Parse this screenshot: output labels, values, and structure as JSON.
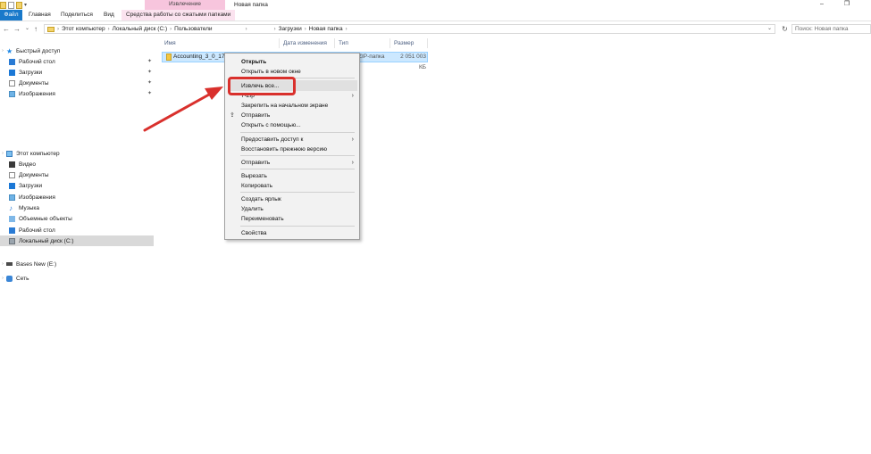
{
  "titlebar": {
    "context_header": "Извлечение",
    "window_title": "Новая папка",
    "minimize": "–",
    "maximize": "❐"
  },
  "ribbon": {
    "tabs": [
      "Файл",
      "Главная",
      "Поделиться",
      "Вид",
      "Средства работы со сжатыми папками"
    ]
  },
  "address": {
    "back": "←",
    "forward": "→",
    "recent": "⌄",
    "up": "↑",
    "crumbs": [
      "Этот компьютер",
      "Локальный диск (C:)",
      "Пользователи",
      "",
      "Загрузки",
      "Новая папка"
    ],
    "separator": "›",
    "dropdown": "⌄",
    "refresh": "↻",
    "search_placeholder": "Поиск: Новая папка"
  },
  "nav": {
    "quick_access": "Быстрый доступ",
    "pinned": [
      {
        "label": "Рабочий стол",
        "icon": "desktop-icon"
      },
      {
        "label": "Загрузки",
        "icon": "downloads-icon"
      },
      {
        "label": "Документы",
        "icon": "documents-icon"
      },
      {
        "label": "Изображения",
        "icon": "pictures-icon"
      }
    ],
    "this_pc": "Этот компьютер",
    "pc_items": [
      {
        "label": "Видео",
        "icon": "video-icon"
      },
      {
        "label": "Документы",
        "icon": "documents-icon"
      },
      {
        "label": "Загрузки",
        "icon": "downloads-icon"
      },
      {
        "label": "Изображения",
        "icon": "pictures-icon"
      },
      {
        "label": "Музыка",
        "icon": "music-icon"
      },
      {
        "label": "Объемные объекты",
        "icon": "3d-objects-icon"
      },
      {
        "label": "Рабочий стол",
        "icon": "desktop-icon"
      },
      {
        "label": "Локальный диск (C:)",
        "icon": "drive-icon"
      }
    ],
    "removable": "Bases New (E:)",
    "network": "Сеть"
  },
  "list": {
    "columns": [
      "Имя",
      "Дата изменения",
      "Тип",
      "Размер"
    ],
    "file": {
      "name": "Accounting_3_0_178_",
      "type": "ZIP-папка",
      "size": "2 051 003 КБ"
    }
  },
  "context_menu": {
    "items": [
      {
        "label": "Открыть",
        "bold": true
      },
      {
        "label": "Открыть в новом окне"
      },
      {
        "label": "Извлечь все..."
      },
      {
        "label": "7-Zip",
        "submenu": true
      },
      {
        "label": "Закрепить на начальном экране"
      },
      {
        "label": "Отправить",
        "icon": "share-icon"
      },
      {
        "label": "Открыть с помощью..."
      },
      {
        "label": "Предоставить доступ к",
        "submenu": true
      },
      {
        "label": "Восстановить прежнюю версию"
      },
      {
        "label": "Отправить",
        "submenu": true
      },
      {
        "label": "Вырезать"
      },
      {
        "label": "Копировать"
      },
      {
        "label": "Создать ярлык"
      },
      {
        "label": "Удалить"
      },
      {
        "label": "Переименовать"
      },
      {
        "label": "Свойства"
      }
    ],
    "submenu_glyph": "›",
    "share_glyph": "⇪"
  },
  "annotation": {
    "color": "#d9302c"
  }
}
